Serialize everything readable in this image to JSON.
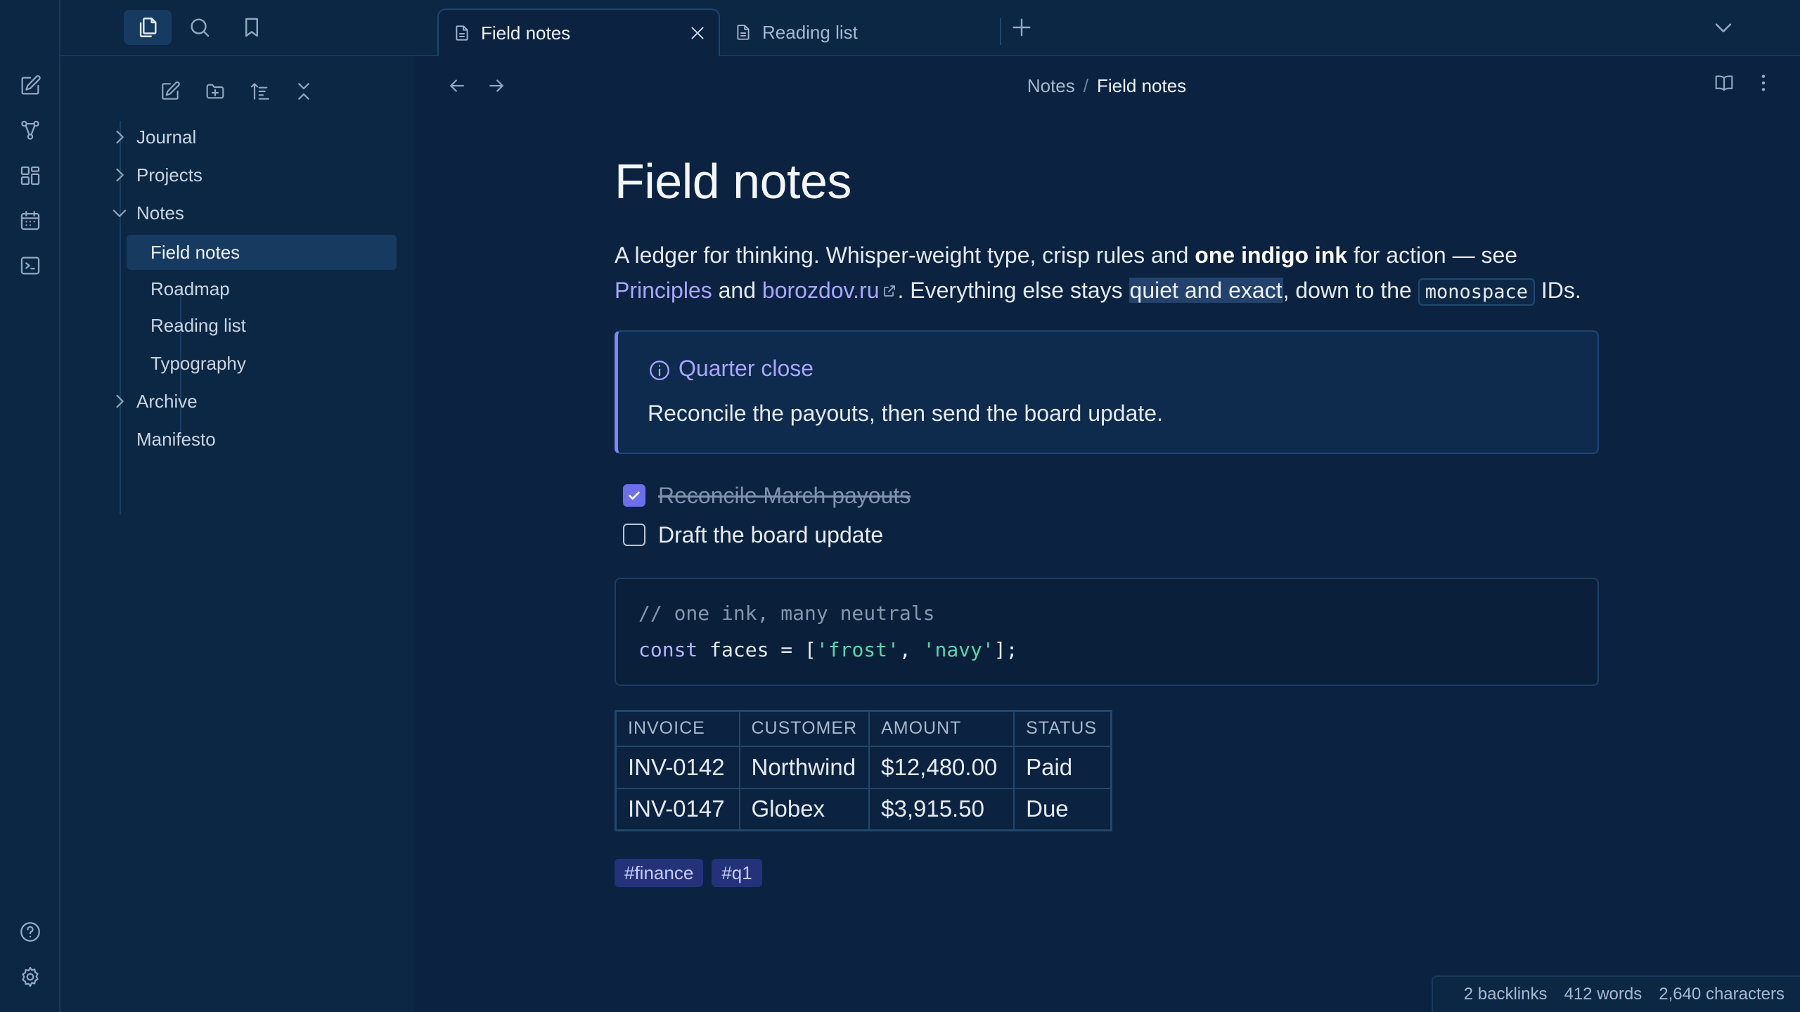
{
  "top_bar": {
    "tabs": [
      {
        "label": "Field notes",
        "active": true
      },
      {
        "label": "Reading list",
        "active": false
      }
    ]
  },
  "sidebar": {
    "tree": [
      {
        "label": "Journal",
        "type": "folder",
        "expanded": false
      },
      {
        "label": "Projects",
        "type": "folder",
        "expanded": false
      },
      {
        "label": "Notes",
        "type": "folder",
        "expanded": true
      },
      {
        "label": "Field notes",
        "type": "file",
        "active": true
      },
      {
        "label": "Roadmap",
        "type": "file"
      },
      {
        "label": "Reading list",
        "type": "file"
      },
      {
        "label": "Typography",
        "type": "file"
      },
      {
        "label": "Archive",
        "type": "folder",
        "expanded": false
      },
      {
        "label": "Manifesto",
        "type": "file"
      }
    ]
  },
  "breadcrumb": {
    "parent": "Notes",
    "separator": "/",
    "current": "Field notes"
  },
  "note": {
    "title": "Field notes",
    "para": {
      "t1": "A ledger for thinking. Whisper-weight type, crisp rules and ",
      "bold": "one indigo ink",
      "t2": " for action — see ",
      "link1": "Principles",
      "t3": " and ",
      "link2": "borozdov.ru",
      "t4": ". Everything else stays ",
      "highlight": "quiet and exact",
      "t5": ", down to the ",
      "code": "monospace",
      "t6": " IDs."
    },
    "callout": {
      "title": "Quarter close",
      "body": "Reconcile the payouts, then send the board update."
    },
    "tasks": [
      {
        "text": "Reconcile March payouts",
        "done": true
      },
      {
        "text": "Draft the board update",
        "done": false
      }
    ],
    "code": {
      "comment": "// one ink, many neutrals",
      "kw": "const",
      "mid": " faces = [",
      "s1": "'frost'",
      "comma": ", ",
      "s2": "'navy'",
      "end": "];"
    },
    "table": {
      "headers": [
        "INVOICE",
        "CUSTOMER",
        "AMOUNT",
        "STATUS"
      ],
      "rows": [
        [
          "INV-0142",
          "Northwind",
          "$12,480.00",
          "Paid"
        ],
        [
          "INV-0147",
          "Globex",
          "$3,915.50",
          "Due"
        ]
      ]
    },
    "tags": [
      "#finance",
      "#q1"
    ]
  },
  "status_bar": {
    "backlinks": "2 backlinks",
    "words": "412 words",
    "characters": "2,640 characters"
  },
  "colors": {
    "accent": "#6b6fe8",
    "link": "#a9a6ff",
    "background": "#0b2340",
    "panel": "#0c2744"
  }
}
